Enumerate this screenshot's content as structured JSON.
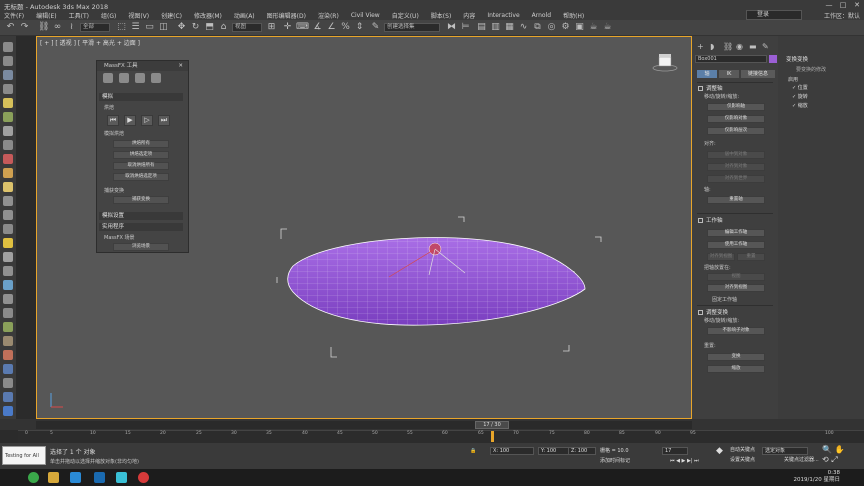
{
  "window": {
    "title": "无标题 - Autodesk 3ds Max 2018",
    "minimize": "—",
    "maximize": "□",
    "close": "✕"
  },
  "menu": [
    "文件(F)",
    "编辑(E)",
    "工具(T)",
    "组(G)",
    "视图(V)",
    "创建(C)",
    "修改器(M)",
    "动画(A)",
    "图形编辑器(D)",
    "渲染(R)",
    "Civil View",
    "自定义(U)",
    "脚本(S)",
    "内容",
    "Interactive",
    "Arnold",
    "帮助(H)"
  ],
  "signin": "登录",
  "workspaces": "工作区：默认",
  "toolbar": {
    "selection_filter": "全部",
    "ref_coord": "视图",
    "named_sel": "创建选择集"
  },
  "viewport": {
    "label": "[ + ] [ 透视 ] [ 平滑 + 高光 + 边面 ]"
  },
  "massfx": {
    "title": "MassFX 工具",
    "sec_sim": "模拟",
    "lab_bake": "烘焙",
    "lab_bake_all": "模拟烘焙",
    "b1": "烘焙所有",
    "b2": "烘焙选定项",
    "b3": "取消烘焙所有",
    "b4": "取消烘焙选定项",
    "lab_capture": "捕获变换",
    "b5": "捕获变换",
    "sec_settings": "模拟设置",
    "sec_util": "实用程序",
    "lab_scene": "MassFX 场景",
    "b6": "浏览场景"
  },
  "right": {
    "objname": "Box001",
    "tab1": "轴",
    "tab2": "IK",
    "tab3": "链接信息",
    "sec_adjust": "调整轴",
    "lab_move": "移动/旋转/缩放:",
    "b1": "仅影响轴",
    "b2": "仅影响对象",
    "b3": "仅影响层次",
    "lab_align": "对齐:",
    "b4": "居中到对象",
    "b5": "对齐到对象",
    "b6": "对齐到世界",
    "lab_axis": "轴:",
    "b7": "重置轴",
    "sec_work": "工作轴",
    "b8": "编辑工作轴",
    "b9": "使用工作轴",
    "b10": "对齐到视图",
    "b11": "重置",
    "lab_placement": "把轴放置在:",
    "b12": "视图",
    "b13": "对齐到视图",
    "lab_placeaxis": "固定工作轴",
    "sec_transform": "调整变换",
    "lab_move2": "移动/旋转/缩放:",
    "b14": "不影响子对象",
    "lab_reset": "重置:",
    "b15": "变换",
    "b16": "缩放"
  },
  "modifiers": {
    "head": "变换变换",
    "sub": "要变换的修改",
    "cap": "启用",
    "items": [
      "位置",
      "旋转",
      "缩放"
    ]
  },
  "timeline": {
    "frame": "17 / 30"
  },
  "ruler": [
    "0",
    "5",
    "10",
    "15",
    "20",
    "25",
    "30",
    "35",
    "40",
    "45",
    "50",
    "55",
    "60",
    "65",
    "70",
    "75",
    "80",
    "85",
    "90",
    "95",
    "100"
  ],
  "status": {
    "script": "Testing for All",
    "line1": "选择了 1 个 对象",
    "line2": "单击并拖动以选择并缩放对象(非均匀地)",
    "x": "X: 100",
    "y": "Y: 100",
    "z": "Z: 100",
    "grid": "栅格 = 10.0",
    "addtime": "添加时间标记",
    "autokey": "自动关键点",
    "setkey": "设置关键点",
    "selected": "选定对象",
    "keyfilter": "关键点过滤器...",
    "frame": "17"
  },
  "clock": {
    "time": "0:38",
    "date": "2019/1/20 星期日"
  }
}
